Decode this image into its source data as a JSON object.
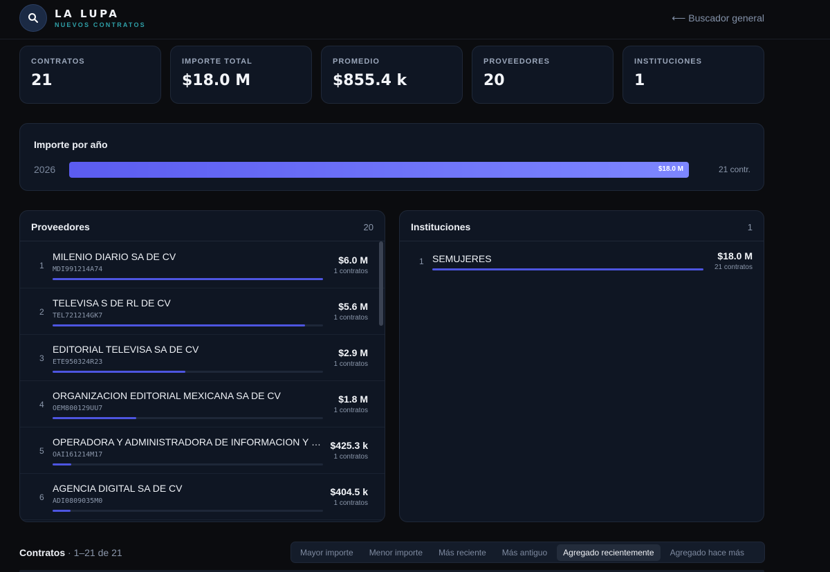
{
  "header": {
    "brand_title": "LA LUPA",
    "brand_subtitle": "NUEVOS CONTRATOS",
    "back_link": "⟵ Buscador general",
    "search_icon": "search-icon"
  },
  "stats": [
    {
      "label": "CONTRATOS",
      "value": "21"
    },
    {
      "label": "IMPORTE TOTAL",
      "value": "$18.0 M"
    },
    {
      "label": "PROMEDIO",
      "value": "$855.4 k"
    },
    {
      "label": "PROVEEDORES",
      "value": "20"
    },
    {
      "label": "INSTITUCIONES",
      "value": "1"
    }
  ],
  "by_year": {
    "title": "Importe por año",
    "rows": [
      {
        "year": "2026",
        "amount": "$18.0 M",
        "count": "21 contr.",
        "fraction": 1.0
      }
    ]
  },
  "providers": {
    "title": "Proveedores",
    "count": "20",
    "items": [
      {
        "index": "1",
        "name": "MILENIO DIARIO SA DE CV",
        "rfc": "MDI991214A74",
        "amount": "$6.0 M",
        "contracts": "1 contratos",
        "fraction": 1.0
      },
      {
        "index": "2",
        "name": "TELEVISA S DE RL DE CV",
        "rfc": "TEL721214GK7",
        "amount": "$5.6 M",
        "contracts": "1 contratos",
        "fraction": 0.933
      },
      {
        "index": "3",
        "name": "EDITORIAL TELEVISA SA DE CV",
        "rfc": "ETE950324R23",
        "amount": "$2.9 M",
        "contracts": "1 contratos",
        "fraction": 0.49
      },
      {
        "index": "4",
        "name": "ORGANIZACION EDITORIAL MEXICANA SA DE CV",
        "rfc": "OEM800129UU7",
        "amount": "$1.8 M",
        "contracts": "1 contratos",
        "fraction": 0.31
      },
      {
        "index": "5",
        "name": "OPERADORA Y ADMINISTRADORA DE INFORMACION Y EDITORIAL SA DE CV",
        "rfc": "OAI161214M17",
        "amount": "$425.3 k",
        "contracts": "1 contratos",
        "fraction": 0.07
      },
      {
        "index": "6",
        "name": "AGENCIA DIGITAL SA DE CV",
        "rfc": "ADI0809035M0",
        "amount": "$404.5 k",
        "contracts": "1 contratos",
        "fraction": 0.067
      }
    ]
  },
  "institutions": {
    "title": "Instituciones",
    "count": "1",
    "items": [
      {
        "index": "1",
        "name": "SEMUJERES",
        "amount": "$18.0 M",
        "contracts": "21 contratos",
        "fraction": 1.0
      }
    ]
  },
  "contracts": {
    "title": "Contratos",
    "range": " · 1–21 de 21",
    "sort_options": [
      {
        "label": "Mayor importe",
        "active": false
      },
      {
        "label": "Menor importe",
        "active": false
      },
      {
        "label": "Más reciente",
        "active": false
      },
      {
        "label": "Más antiguo",
        "active": false
      },
      {
        "label": "Agregado recientemente",
        "active": true
      },
      {
        "label": "Agregado hace más",
        "active": false
      }
    ]
  },
  "colors": {
    "accent": "#5b5cf0",
    "accent_light": "#7d86ff",
    "brand_sub": "#2fa0a8",
    "background": "#0b0c0f",
    "panel": "#0f1623"
  }
}
